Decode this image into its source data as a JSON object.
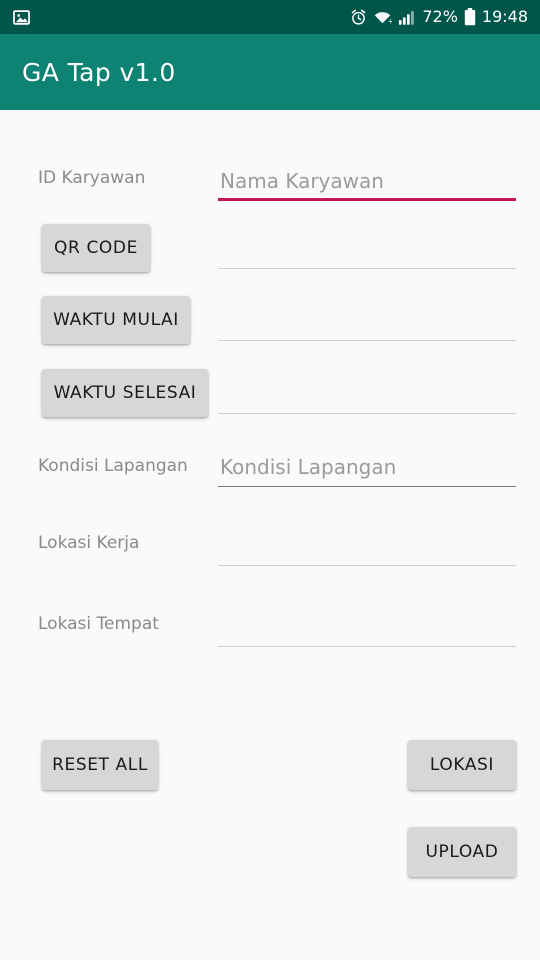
{
  "status_bar": {
    "left_icons": [
      {
        "name": "image-icon",
        "glyph": "image"
      }
    ],
    "right_icons": [
      {
        "name": "alarm-icon",
        "glyph": "alarm"
      },
      {
        "name": "wifi-icon",
        "glyph": "wifi"
      },
      {
        "name": "signal-icon",
        "glyph": "signal"
      }
    ],
    "battery_percent": "72%",
    "clock": "19:48",
    "background_color": "#00564B"
  },
  "app_bar": {
    "title": "GA Tap v1.0",
    "background_color": "#0E8273",
    "text_color": "#FFFFFF"
  },
  "theme": {
    "page_background": "#FAFAFA",
    "accent_underline": "#C2185B",
    "button_background": "#D6D7D7",
    "label_color": "#8A8A8A",
    "placeholder_color": "#9B9B9B"
  },
  "form": {
    "rows": [
      {
        "label": "ID Karyawan",
        "field_placeholder": "Nama Karyawan",
        "field_value": "",
        "focused": true
      },
      {
        "label": "",
        "field_placeholder": "",
        "field_value": "",
        "focused": false
      },
      {
        "label": "",
        "field_placeholder": "",
        "field_value": "",
        "focused": false
      },
      {
        "label": "",
        "field_placeholder": "",
        "field_value": "",
        "focused": false
      },
      {
        "label": "Kondisi Lapangan",
        "field_placeholder": "Kondisi Lapangan",
        "field_value": "",
        "focused": false
      },
      {
        "label": "Lokasi Kerja",
        "field_placeholder": "",
        "field_value": "",
        "focused": false
      },
      {
        "label": "Lokasi Tempat",
        "field_placeholder": "",
        "field_value": "",
        "focused": false
      }
    ],
    "action_buttons": [
      {
        "id": "qr-code",
        "label": "QR CODE"
      },
      {
        "id": "waktu-mulai",
        "label": "WAKTU MULAI"
      },
      {
        "id": "waktu-selesai",
        "label": "WAKTU SELESAI"
      }
    ],
    "footer_buttons": [
      {
        "id": "reset-all",
        "label": "RESET ALL"
      },
      {
        "id": "lokasi",
        "label": "LOKASI"
      },
      {
        "id": "upload",
        "label": "UPLOAD"
      }
    ]
  }
}
